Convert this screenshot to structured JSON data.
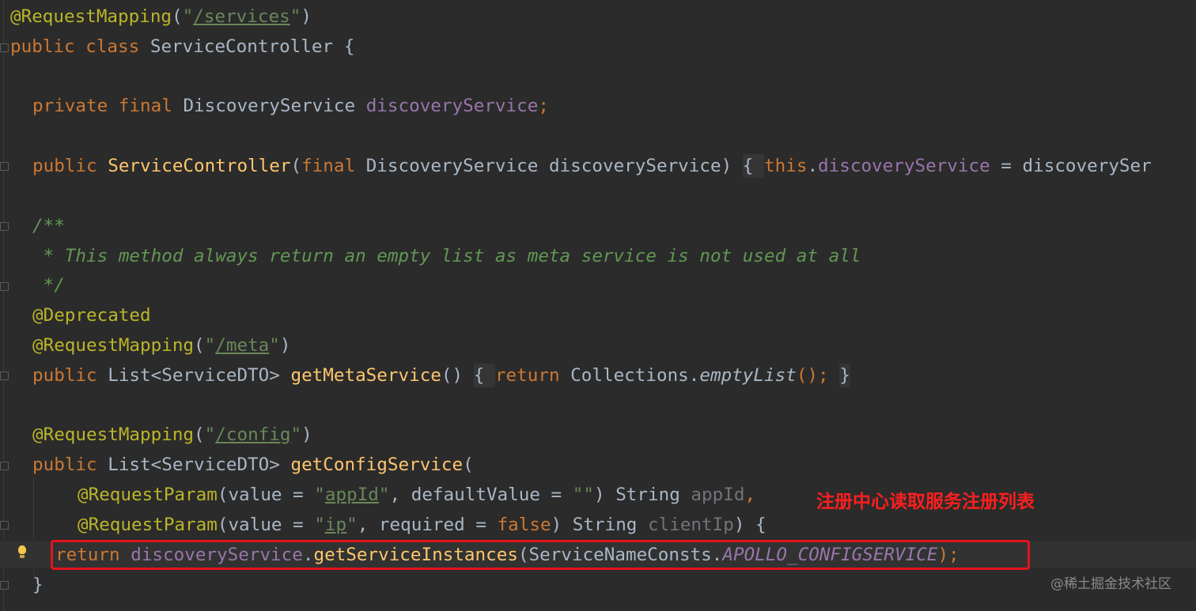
{
  "code_lines": [
    {
      "parts": [
        "@RequestMapping",
        "(",
        "\"",
        "/services",
        "\"",
        ")"
      ]
    },
    {
      "parts": [
        "public class ",
        "ServiceController {"
      ]
    },
    {
      "parts": []
    },
    {
      "parts": [
        "private final ",
        "DiscoveryService ",
        "discoveryService",
        ";"
      ]
    },
    {
      "parts": []
    },
    {
      "parts": [
        "public ",
        "ServiceController",
        "(",
        "final ",
        "DiscoveryService discoveryService) ",
        "{ ",
        "this",
        ".",
        "discoveryService",
        " = discoverySer"
      ]
    },
    {
      "parts": []
    },
    {
      "parts": [
        "/**"
      ]
    },
    {
      "parts": [
        " * This method always return an empty list as meta service is not used at all"
      ]
    },
    {
      "parts": [
        " */"
      ]
    },
    {
      "parts": [
        "@Deprecated"
      ]
    },
    {
      "parts": [
        "@RequestMapping",
        "(",
        "\"",
        "/meta",
        "\"",
        ")"
      ]
    },
    {
      "parts": [
        "public ",
        "List<ServiceDTO> ",
        "getMetaService",
        "() ",
        "{ ",
        "return ",
        "Collections.",
        "emptyList",
        "(); ",
        "}"
      ]
    },
    {
      "parts": []
    },
    {
      "parts": [
        "@RequestMapping",
        "(",
        "\"",
        "/config",
        "\"",
        ")"
      ]
    },
    {
      "parts": [
        "public ",
        "List<ServiceDTO> ",
        "getConfigService",
        "("
      ]
    },
    {
      "parts": [
        "@RequestParam",
        "(value = ",
        "\"",
        "appId",
        "\"",
        ", defaultValue = ",
        "\"\"",
        ") String ",
        "appId",
        ","
      ]
    },
    {
      "parts": [
        "@RequestParam",
        "(value = ",
        "\"",
        "ip",
        "\"",
        ", required = ",
        "false",
        ") String ",
        "clientIp",
        ") {"
      ]
    },
    {
      "parts": [
        "return ",
        "discoveryService",
        ".",
        "getServiceInstances",
        "(ServiceNameConsts.",
        "APOLLO_CONFIGSERVICE",
        ");"
      ]
    },
    {
      "parts": [
        "}"
      ]
    }
  ],
  "annotation_note": "注册中心读取服务注册列表",
  "watermark": "@稀土掘金技术社区",
  "icons": {
    "lightbulb": "intention-bulb-icon",
    "fold_marker": "fold-icon"
  },
  "colors": {
    "background": "#2b2b2b",
    "keyword": "#cc7832",
    "annotation": "#bbb529",
    "string": "#6a8759",
    "method": "#ffc66d",
    "field": "#9876aa",
    "comment": "#629755",
    "default_text": "#a9b7c6",
    "highlight_box": "#e5131c",
    "note_text": "#ff1e1e"
  }
}
